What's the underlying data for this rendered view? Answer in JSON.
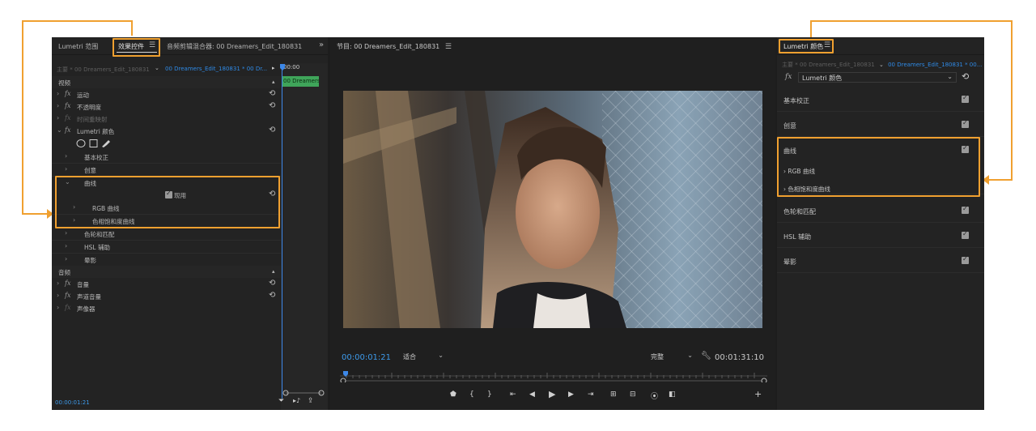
{
  "colors": {
    "accent": "#f0a030",
    "timecode": "#3d9aea",
    "clip": "#3fa55a",
    "panel": "#232323"
  },
  "left_panel": {
    "tabs": [
      "Lumetri 范围",
      "效果控件",
      "音频剪辑混合器: 00 Dreamers_Edit_180831"
    ],
    "tab_menu": "☰",
    "overflow": "»",
    "sequence_master": "主要 * 00 Dreamers_Edit_180831",
    "sequence_clip": "00 Dreamers_Edit_180831 * 00 Dr...",
    "ruler_time": "00:00",
    "clip_name": "00 Dreamers",
    "video_header": "视频",
    "audio_header": "音频",
    "video_rows": [
      "运动",
      "不透明度",
      "时间重映射",
      "Lumetri 颜色"
    ],
    "lumetri_rows": [
      "基本校正",
      "创意",
      "曲线"
    ],
    "enable_label": "现用",
    "curves_rows": [
      "RGB 曲线",
      "色相饱和度曲线"
    ],
    "lumetri_rows_after": [
      "色轮和匹配",
      "HSL 辅助",
      "晕影"
    ],
    "audio_rows": [
      "音量",
      "声道音量",
      "声像器"
    ],
    "current_time": "00:00:01:21"
  },
  "program": {
    "title": "节目: 00 Dreamers_Edit_180831",
    "tab_menu": "☰",
    "timecode": "00:00:01:21",
    "fit": "适合",
    "quality": "完整",
    "duration": "00:01:31:10"
  },
  "right_panel": {
    "title": "Lumetri 颜色",
    "tab_menu": "☰",
    "sequence_master": "主要 * 00 Dreamers_Edit_180831",
    "sequence_clip": "00 Dreamers_Edit_180831 * 00...",
    "effect": "Lumetri 颜色",
    "fx_label": "fx",
    "sections": [
      "基本校正",
      "创意",
      "曲线"
    ],
    "curves_subs": [
      "RGB 曲线",
      "色相饱和度曲线"
    ],
    "sections_after": [
      "色轮和匹配",
      "HSL 辅助",
      "晕影"
    ]
  }
}
